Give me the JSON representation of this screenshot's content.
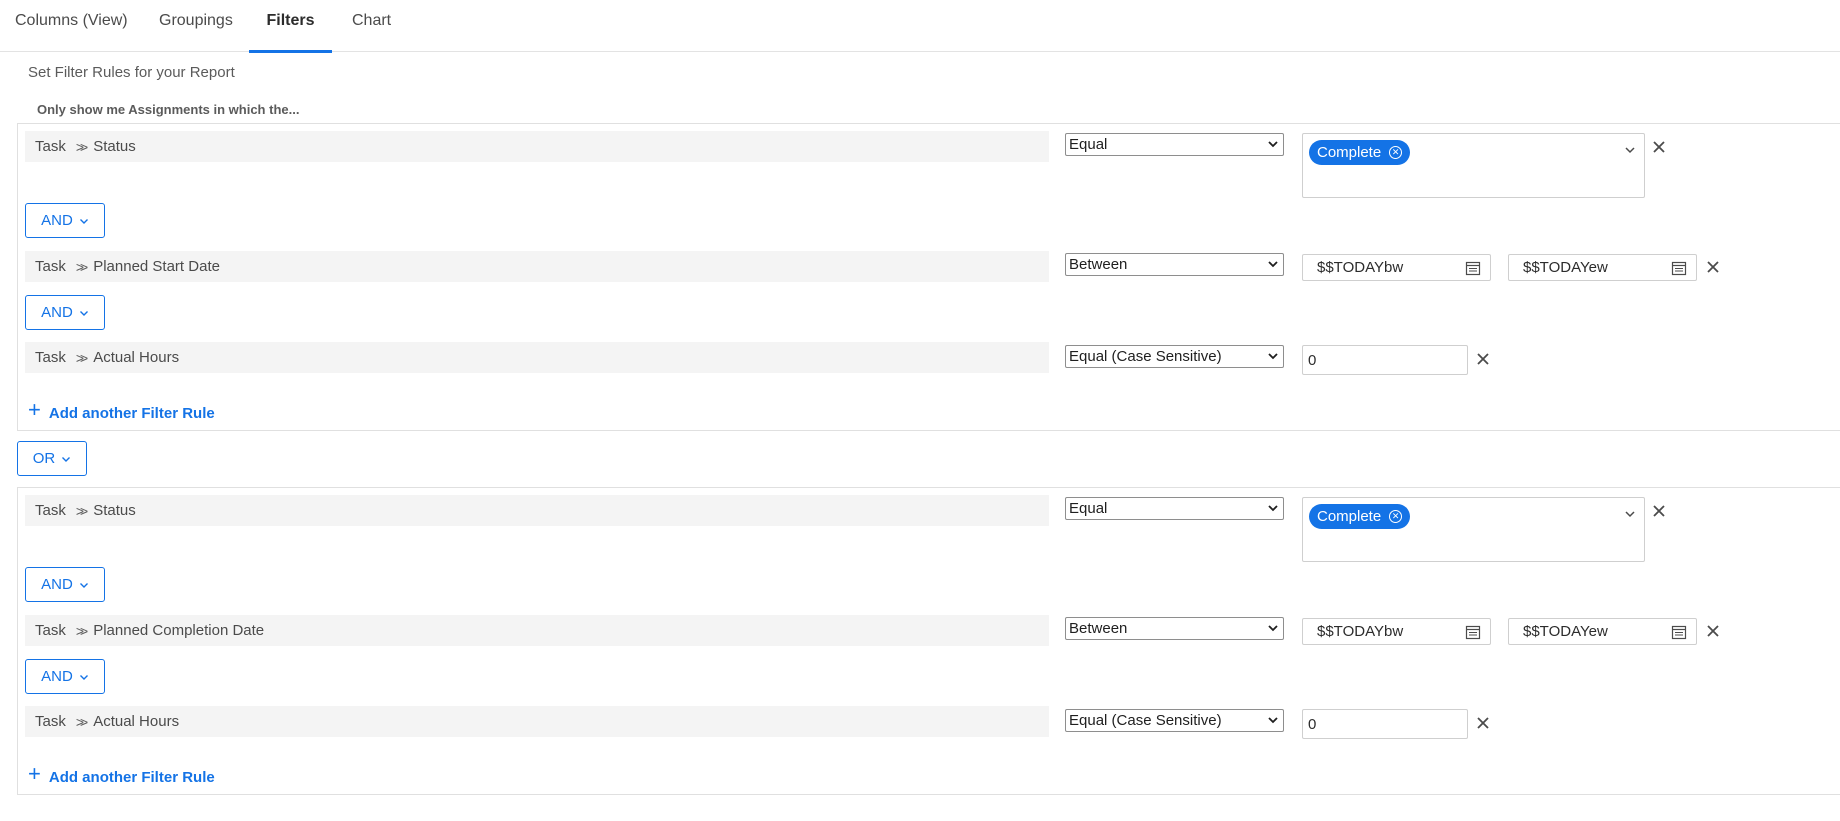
{
  "tabs": [
    {
      "label": "Columns (View)"
    },
    {
      "label": "Groupings"
    },
    {
      "label": "Filters"
    },
    {
      "label": "Chart"
    }
  ],
  "active_tab": "Filters",
  "heading": "Set Filter Rules for your Report",
  "subheading": "Only show me Assignments in which the...",
  "accent_color": "#1473e6",
  "groups": [
    {
      "rules": [
        {
          "object": "Task",
          "field": "Status",
          "operator": "Equal",
          "value_chip": "Complete"
        },
        {
          "object": "Task",
          "field": "Planned Start Date",
          "operator": "Between",
          "value_from": "$$TODAYbw",
          "value_to": "$$TODAYew"
        },
        {
          "object": "Task",
          "field": "Actual Hours",
          "operator": "Equal (Case Sensitive)",
          "value": "0"
        }
      ],
      "connectors": [
        "AND",
        "AND"
      ],
      "add_rule_label": "Add another Filter Rule"
    },
    {
      "rules": [
        {
          "object": "Task",
          "field": "Status",
          "operator": "Equal",
          "value_chip": "Complete"
        },
        {
          "object": "Task",
          "field": "Planned Completion Date",
          "operator": "Between",
          "value_from": "$$TODAYbw",
          "value_to": "$$TODAYew"
        },
        {
          "object": "Task",
          "field": "Actual Hours",
          "operator": "Equal (Case Sensitive)",
          "value": "0"
        }
      ],
      "connectors": [
        "AND",
        "AND"
      ],
      "add_rule_label": "Add another Filter Rule"
    }
  ],
  "group_connector": "OR"
}
